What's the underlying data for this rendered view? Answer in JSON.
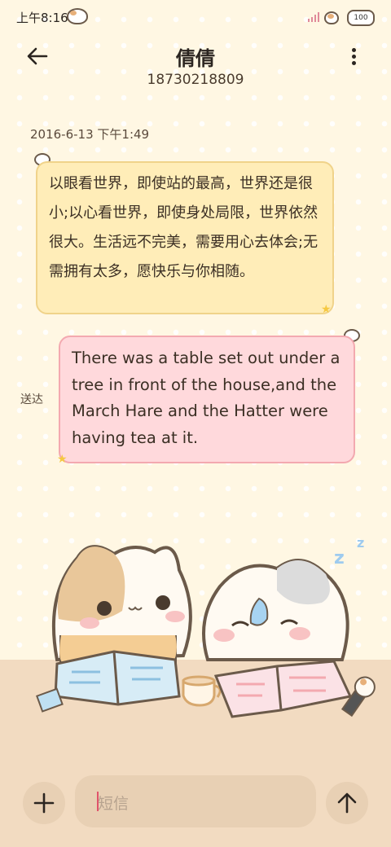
{
  "status_bar": {
    "time": "上午8:16",
    "battery": "100"
  },
  "header": {
    "contact_name": "倩倩",
    "phone_number": "18730218809"
  },
  "conversation": {
    "timestamp": "2016-6-13 下午1:49",
    "messages": [
      {
        "direction": "incoming",
        "text": "以眼看世界，即使站的最高，世界还是很小;以心看世界，即使身处局限，世界依然很大。生活远不完美，需要用心去体会;无需拥有太多，愿快乐与你相随。"
      },
      {
        "direction": "outgoing",
        "text": "There was a table set out under a tree in front of the house,and the March Hare and the Hatter were having tea at it.",
        "status": "送达"
      }
    ]
  },
  "composer": {
    "placeholder": "短信"
  },
  "icons": {
    "back": "back-arrow-icon",
    "more": "more-vertical-icon",
    "add": "plus-icon",
    "send": "send-arrow-icon"
  }
}
